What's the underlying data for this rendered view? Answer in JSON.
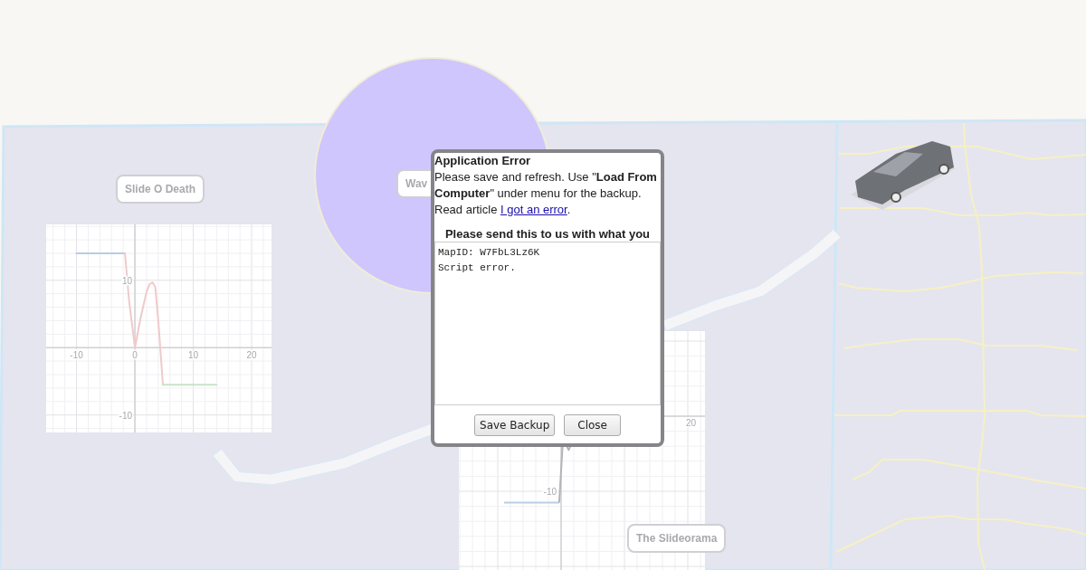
{
  "canvas": {
    "labels": [
      {
        "text": "Slide O Death"
      },
      {
        "text": "Wav"
      },
      {
        "text": "The Slideorama"
      }
    ],
    "graphs": [
      {
        "chart_data": {
          "type": "line",
          "grid": true,
          "x": [
            -10,
            -1.7,
            -1,
            0,
            1,
            2,
            2.5,
            3,
            3.5,
            4,
            4.8,
            14
          ],
          "xlim": [
            -15.2,
            23.4
          ],
          "ylim": [
            -12.6,
            18.3
          ],
          "xticks": [
            -10,
            0,
            10,
            20
          ],
          "yticks": [
            -10,
            10
          ],
          "series": [
            {
              "color": "#b9cde3",
              "values": [
                14,
                14,
                null,
                null,
                null,
                null,
                null,
                null,
                null,
                null,
                null,
                null
              ]
            },
            {
              "color": "#efcaca",
              "values": [
                null,
                14,
                7,
                0,
                4.5,
                8.3,
                9.4,
                9.7,
                9,
                4,
                -5.5,
                null
              ]
            },
            {
              "color": "#c9e2c9",
              "values": [
                null,
                null,
                null,
                null,
                null,
                null,
                null,
                null,
                null,
                null,
                -5.5,
                -5.5
              ]
            }
          ]
        }
      },
      {
        "tick_labels": [
          {
            "text": "20"
          },
          {
            "text": "-10"
          }
        ]
      }
    ]
  },
  "dialog": {
    "title": "Application Error",
    "message": "Please save and refresh. Use \"**Load From Computer**\" under menu for the backup. Read article",
    "link": "I got an error",
    "link_suffix": ".",
    "prompt": "Please send this to us with what you",
    "report": "MapID: W7FbL3Lz6K\nScript error.",
    "buttons": [
      {
        "label": "Save Backup"
      },
      {
        "label": "Close"
      }
    ]
  }
}
